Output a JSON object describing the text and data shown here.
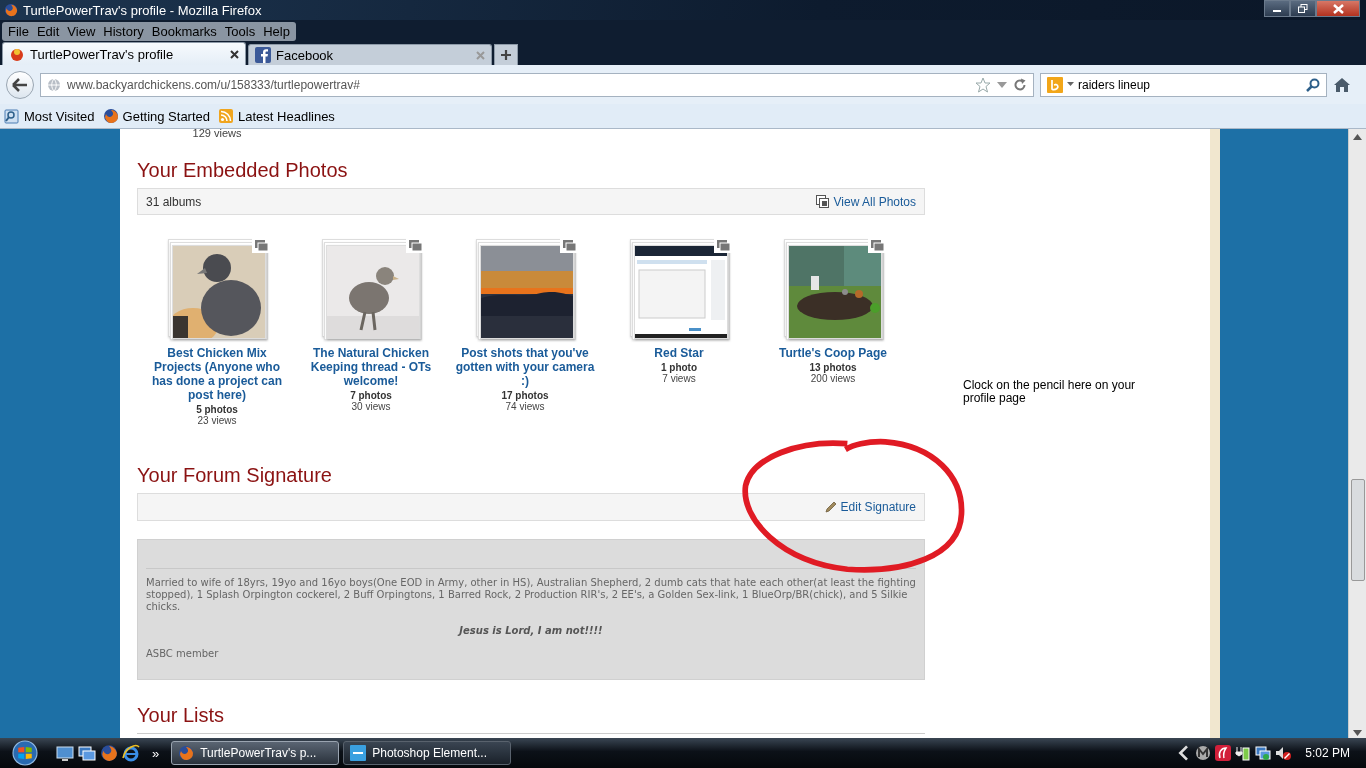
{
  "window": {
    "title": "TurtlePowerTrav's profile - Mozilla Firefox"
  },
  "menu": [
    "File",
    "Edit",
    "View",
    "History",
    "Bookmarks",
    "Tools",
    "Help"
  ],
  "tabs": [
    {
      "label": "TurtlePowerTrav's profile",
      "selected": true,
      "kind": "site"
    },
    {
      "label": "Facebook",
      "selected": false,
      "kind": "facebook"
    }
  ],
  "address": {
    "url": "www.backyardchickens.com/u/158333/turtlepowertrav#"
  },
  "search": {
    "value": "raiders lineup"
  },
  "bookmarks": [
    {
      "label": "Most Visited",
      "kind": "folder"
    },
    {
      "label": "Getting Started",
      "kind": "firefox"
    },
    {
      "label": "Latest Headlines",
      "kind": "feed"
    }
  ],
  "page": {
    "top_views": "129 views",
    "photos": {
      "heading": "Your Embedded Photos",
      "count": "31 albums",
      "link": "View All Photos",
      "albums": [
        {
          "title": "Best Chicken Mix Projects (Anyone who has done a project can post here)",
          "photos": "5 photos",
          "views": "23 views"
        },
        {
          "title": "The Natural Chicken Keeping thread - OTs welcome!",
          "photos": "7 photos",
          "views": "30 views"
        },
        {
          "title": "Post shots that you've gotten with your camera :)",
          "photos": "17 photos",
          "views": "74 views"
        },
        {
          "title": "Red Star",
          "photos": "1 photo",
          "views": "7 views"
        },
        {
          "title": "Turtle's Coop Page",
          "photos": "13 photos",
          "views": "200 views"
        }
      ]
    },
    "note": "Clock on the pencil here on your profile page",
    "signature": {
      "heading": "Your Forum Signature",
      "link": "Edit Signature",
      "body": "Married to wife of 18yrs, 19yo and 16yo boys(One EOD in Army, other in HS), Australian Shepherd, 2 dumb cats that hate each other(at least the fighting stopped), 1 Splash Orpington cockerel, 2 Buff Orpingtons, 1 Barred Rock, 2 Production RIR's, 2 EE's, a Golden Sex-link, 1 BlueOrp/BR(chick), and 5 Silkie chicks.",
      "motto": "Jesus is Lord, I am not!!!!",
      "footer": "ASBC member"
    },
    "lists_heading": "Your Lists"
  },
  "taskbar": {
    "overflow": "»",
    "tasks": [
      {
        "label": "TurtlePowerTrav's p...",
        "selected": true,
        "kind": "firefox"
      },
      {
        "label": "Photoshop Element...",
        "selected": false,
        "kind": "pse"
      }
    ],
    "clock": "5:02 PM"
  }
}
